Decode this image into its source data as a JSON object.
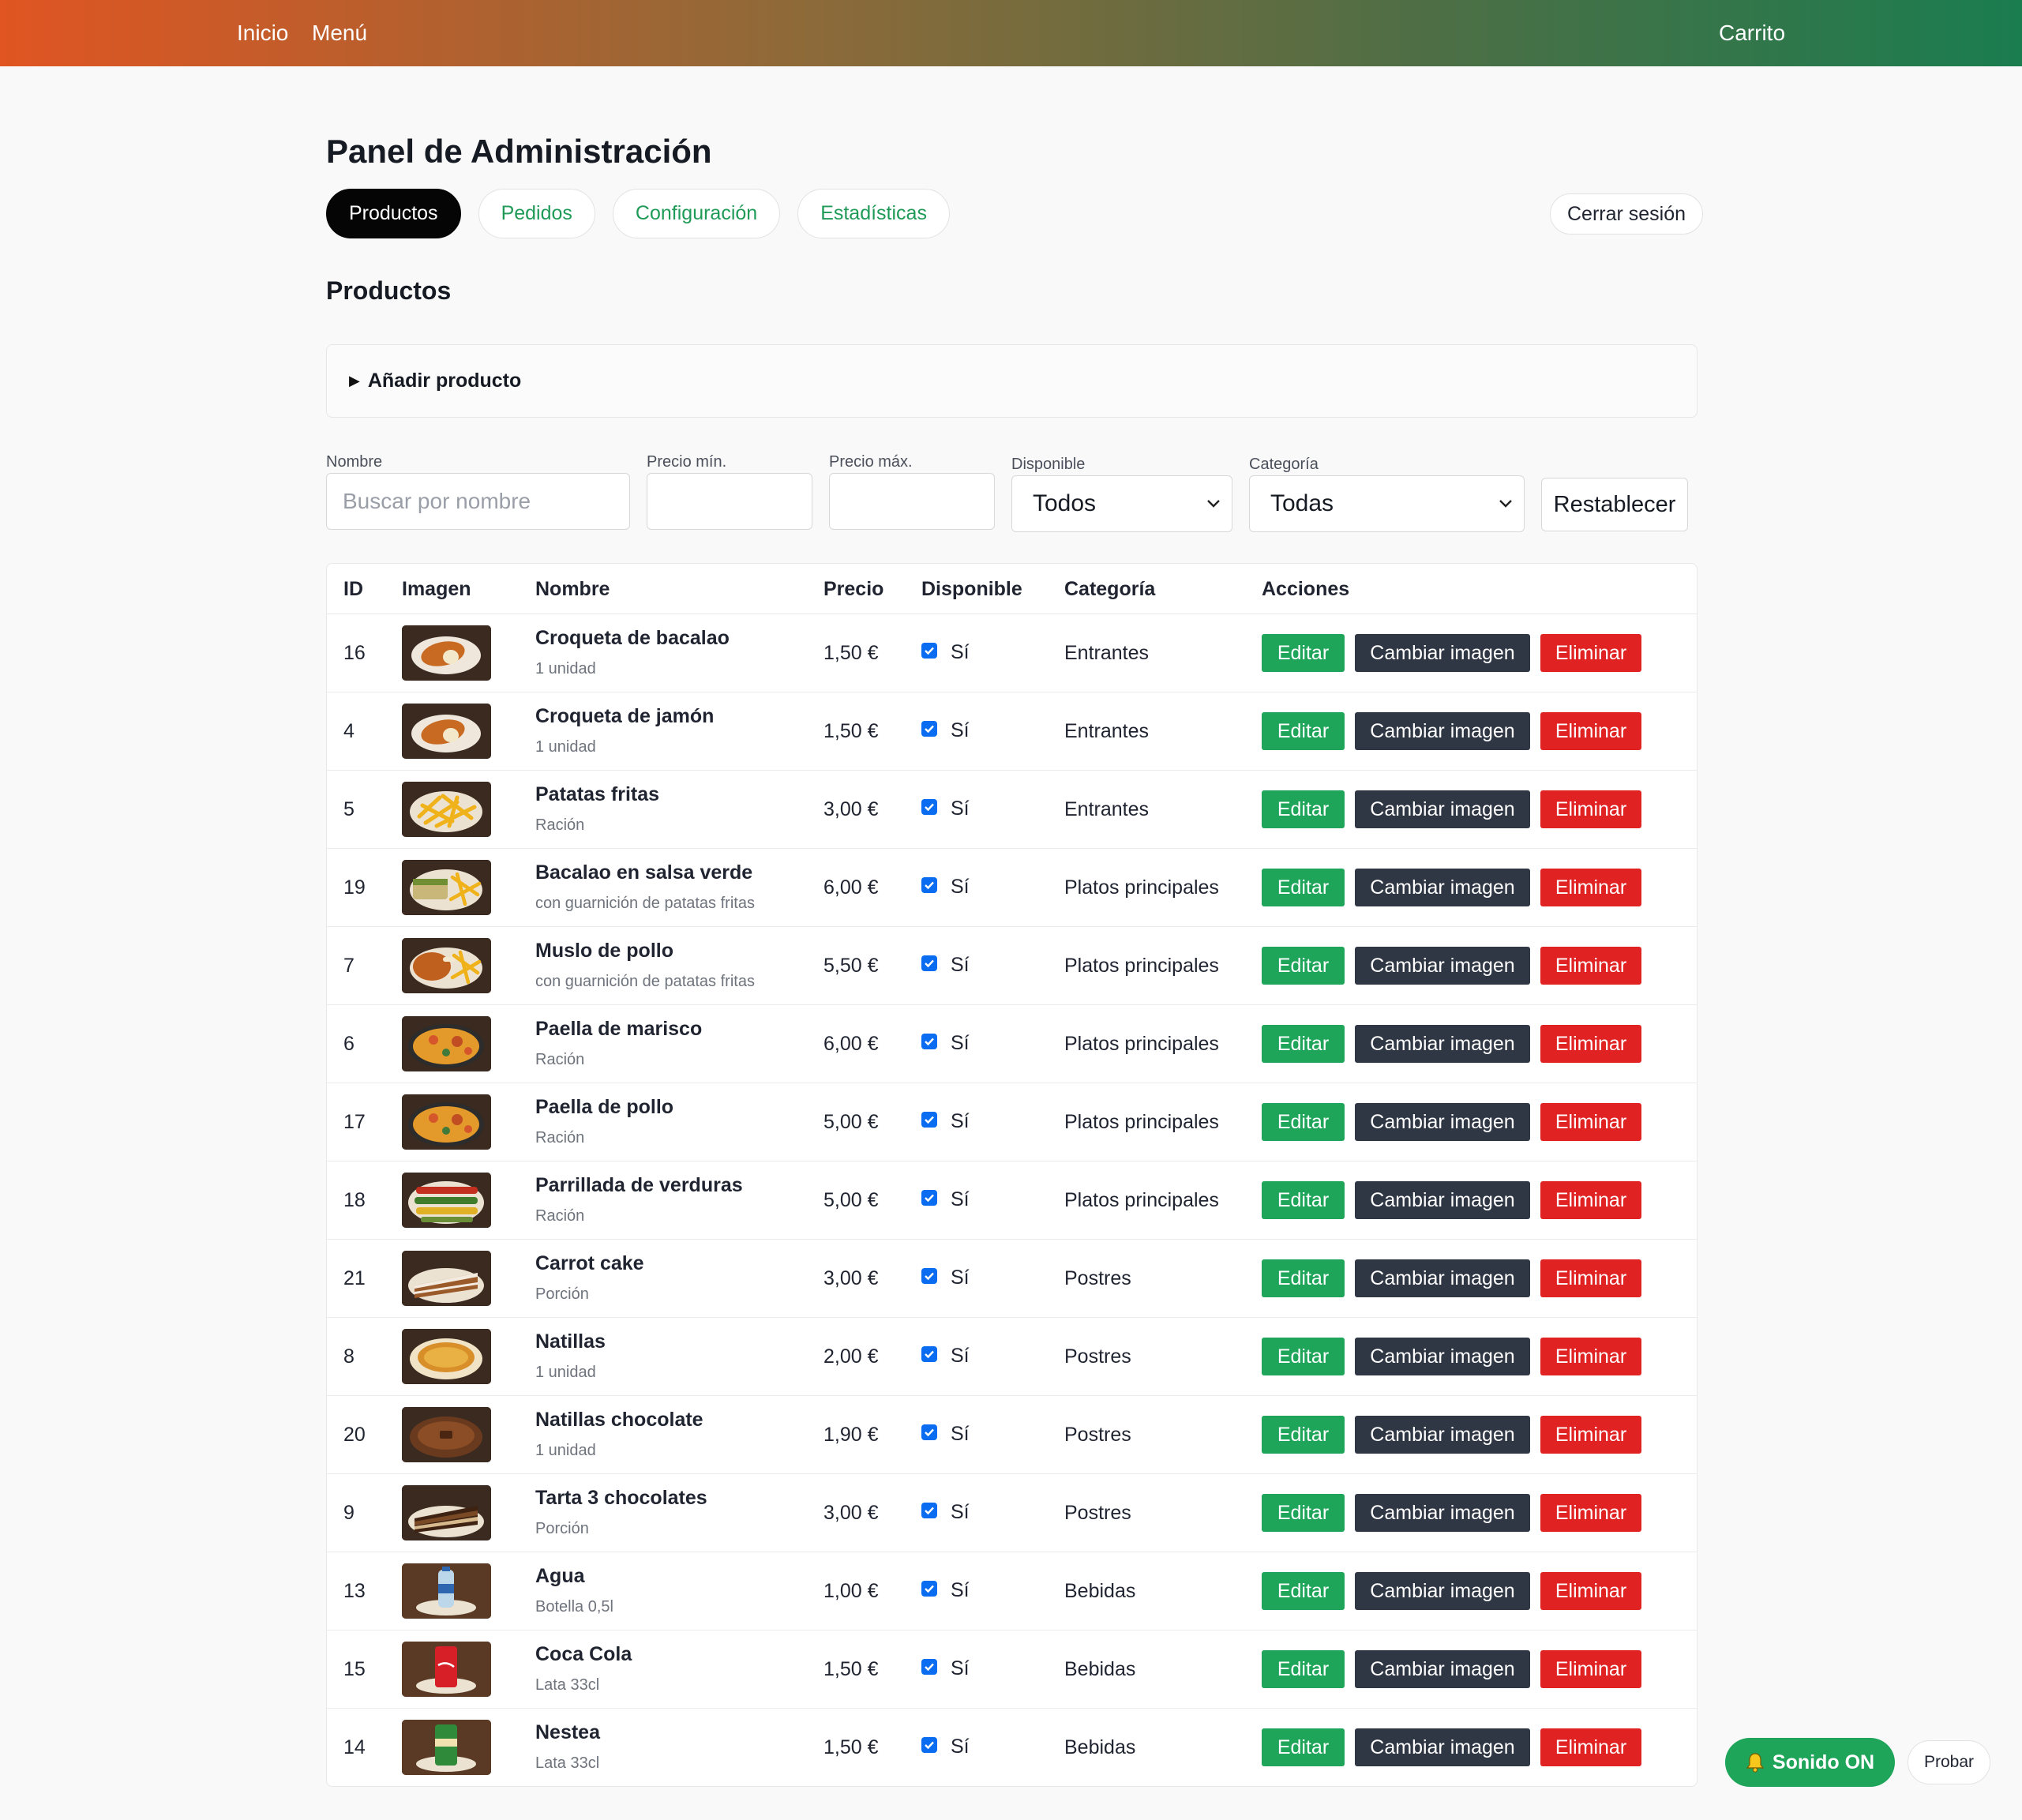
{
  "nav": {
    "home": "Inicio",
    "menu": "Menú",
    "cart": "Carrito"
  },
  "page_title": "Panel de Administración",
  "tabs": [
    {
      "label": "Productos",
      "active": true
    },
    {
      "label": "Pedidos",
      "active": false
    },
    {
      "label": "Configuración",
      "active": false
    },
    {
      "label": "Estadísticas",
      "active": false
    }
  ],
  "logout_label": "Cerrar sesión",
  "section_title": "Productos",
  "add_product_label": "Añadir producto",
  "filters": {
    "name_label": "Nombre",
    "name_placeholder": "Buscar por nombre",
    "min_price_label": "Precio mín.",
    "max_price_label": "Precio máx.",
    "available_label": "Disponible",
    "available_value": "Todos",
    "category_label": "Categoría",
    "category_value": "Todas",
    "reset_label": "Restablecer"
  },
  "table": {
    "headers": [
      "ID",
      "Imagen",
      "Nombre",
      "Precio",
      "Disponible",
      "Categoría",
      "Acciones"
    ],
    "actions": {
      "edit": "Editar",
      "change_image": "Cambiar imagen",
      "delete": "Eliminar"
    },
    "rows": [
      {
        "id": "16",
        "name": "Croqueta de bacalao",
        "desc": "1 unidad",
        "price": "1,50 €",
        "available": "Sí",
        "category": "Entrantes",
        "thumb": "croquette"
      },
      {
        "id": "4",
        "name": "Croqueta de jamón",
        "desc": "1 unidad",
        "price": "1,50 €",
        "available": "Sí",
        "category": "Entrantes",
        "thumb": "croquette"
      },
      {
        "id": "5",
        "name": "Patatas fritas",
        "desc": "Ración",
        "price": "3,00 €",
        "available": "Sí",
        "category": "Entrantes",
        "thumb": "fries"
      },
      {
        "id": "19",
        "name": "Bacalao en salsa verde",
        "desc": "con guarnición de patatas fritas",
        "price": "6,00 €",
        "available": "Sí",
        "category": "Platos principales",
        "thumb": "fish-fries"
      },
      {
        "id": "7",
        "name": "Muslo de pollo",
        "desc": "con guarnición de patatas fritas",
        "price": "5,50 €",
        "available": "Sí",
        "category": "Platos principales",
        "thumb": "chicken-fries"
      },
      {
        "id": "6",
        "name": "Paella de marisco",
        "desc": "Ración",
        "price": "6,00 €",
        "available": "Sí",
        "category": "Platos principales",
        "thumb": "paella"
      },
      {
        "id": "17",
        "name": "Paella de pollo",
        "desc": "Ración",
        "price": "5,00 €",
        "available": "Sí",
        "category": "Platos principales",
        "thumb": "paella"
      },
      {
        "id": "18",
        "name": "Parrillada de verduras",
        "desc": "Ración",
        "price": "5,00 €",
        "available": "Sí",
        "category": "Platos principales",
        "thumb": "veggies"
      },
      {
        "id": "21",
        "name": "Carrot cake",
        "desc": "Porción",
        "price": "3,00 €",
        "available": "Sí",
        "category": "Postres",
        "thumb": "cake"
      },
      {
        "id": "8",
        "name": "Natillas",
        "desc": "1 unidad",
        "price": "2,00 €",
        "available": "Sí",
        "category": "Postres",
        "thumb": "custard"
      },
      {
        "id": "20",
        "name": "Natillas chocolate",
        "desc": "1 unidad",
        "price": "1,90 €",
        "available": "Sí",
        "category": "Postres",
        "thumb": "choc-custard"
      },
      {
        "id": "9",
        "name": "Tarta 3 chocolates",
        "desc": "Porción",
        "price": "3,00 €",
        "available": "Sí",
        "category": "Postres",
        "thumb": "choc-cake"
      },
      {
        "id": "13",
        "name": "Agua",
        "desc": "Botella 0,5l",
        "price": "1,00 €",
        "available": "Sí",
        "category": "Bebidas",
        "thumb": "water"
      },
      {
        "id": "15",
        "name": "Coca Cola",
        "desc": "Lata 33cl",
        "price": "1,50 €",
        "available": "Sí",
        "category": "Bebidas",
        "thumb": "cola"
      },
      {
        "id": "14",
        "name": "Nestea",
        "desc": "Lata 33cl",
        "price": "1,50 €",
        "available": "Sí",
        "category": "Bebidas",
        "thumb": "nestea"
      }
    ]
  },
  "sound_label": "Sonido ON",
  "test_label": "Probar",
  "colors": {
    "primary_green": "#1fa55a",
    "danger": "#e02222",
    "dark": "#2f3644"
  }
}
